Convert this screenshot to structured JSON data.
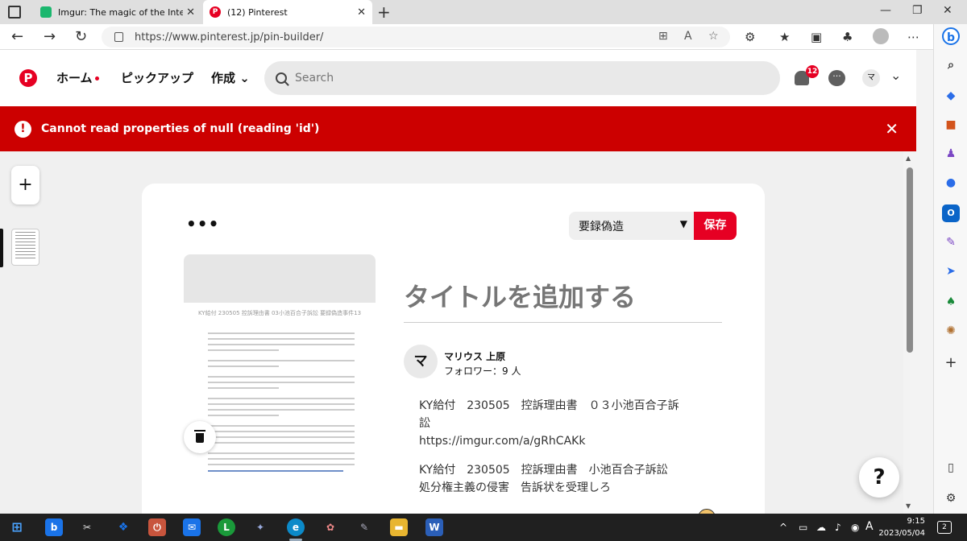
{
  "browser": {
    "tabs": [
      {
        "title": "Imgur: The magic of the Internet",
        "favicon": "imgur-icon"
      },
      {
        "title": "(12) Pinterest",
        "favicon": "pinterest-icon"
      }
    ],
    "url": "https://www.pinterest.jp/pin-builder/"
  },
  "pinterest": {
    "logo": "P",
    "nav": {
      "home": "ホーム",
      "pickup": "ピックアップ",
      "create": "作成"
    },
    "search_placeholder": "Search",
    "notification_count": "12",
    "avatar_initial": "マ"
  },
  "error": {
    "message": "Cannot read properties of null (reading 'id')"
  },
  "pin_builder": {
    "more_label": "•••",
    "board": "要録偽造",
    "save_label": "保存",
    "title_placeholder": "タイトルを追加する",
    "author": {
      "initial": "マ",
      "name": "マリウス 上原",
      "followers": "フォロワー：9 人"
    },
    "description": [
      "KY給付　230505　控訴理由書　０３小池百合子訴訟",
      "https://imgur.com/a/gRhCAKk",
      "KY給付　230505　控訴理由書　小池百合子訴訟　処分権主義の侵害　告訴状を受理しろ"
    ],
    "preview_header": "KY給付 230505 控訴理由書 03小池百合子訴訟 要録偽造事件13",
    "help_label": "?"
  },
  "taskbar": {
    "time": "9:15",
    "date": "2023/05/04",
    "ime": "A",
    "notifications": "2"
  },
  "colors": {
    "accent": "#e60023",
    "error": "#cc0000"
  }
}
